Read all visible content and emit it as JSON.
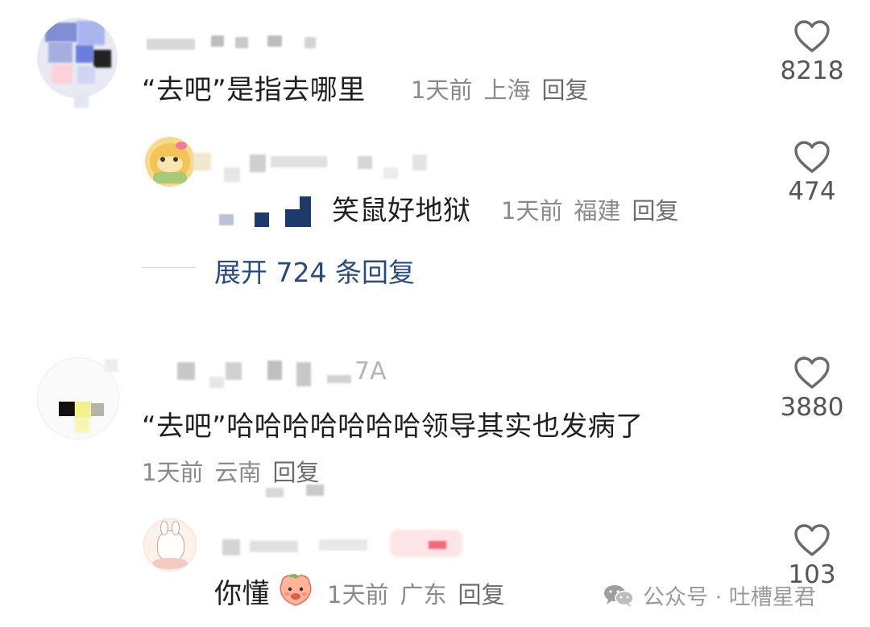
{
  "comments": [
    {
      "text": "“去吧”是指去哪里",
      "time": "1天前",
      "location": "上海",
      "reply_label": "回复",
      "likes": "8218"
    },
    {
      "text": "笑鼠好地狱",
      "time": "1天前",
      "location": "福建",
      "reply_label": "回复",
      "likes": "474"
    },
    {
      "expand_label": "展开 724 条回复"
    },
    {
      "name_suffix": "7A",
      "text": "“去吧”哈哈哈哈哈哈哈领导其实也发病了",
      "time": "1天前",
      "location": "云南",
      "reply_label": "回复",
      "likes": "3880"
    },
    {
      "text": "你懂",
      "time": "1天前",
      "location": "广东",
      "reply_label": "回复",
      "likes": "103"
    }
  ],
  "watermark": {
    "text": "公众号 · 吐槽星君",
    "icon": "wechat-icon"
  },
  "icons": {
    "like": "heart-icon",
    "emoji": "peach-face-icon"
  },
  "colors": {
    "text": "#1f1f1f",
    "meta": "#8a8a8a",
    "link": "#2a4b7a",
    "heart": "#6a6a6a"
  }
}
